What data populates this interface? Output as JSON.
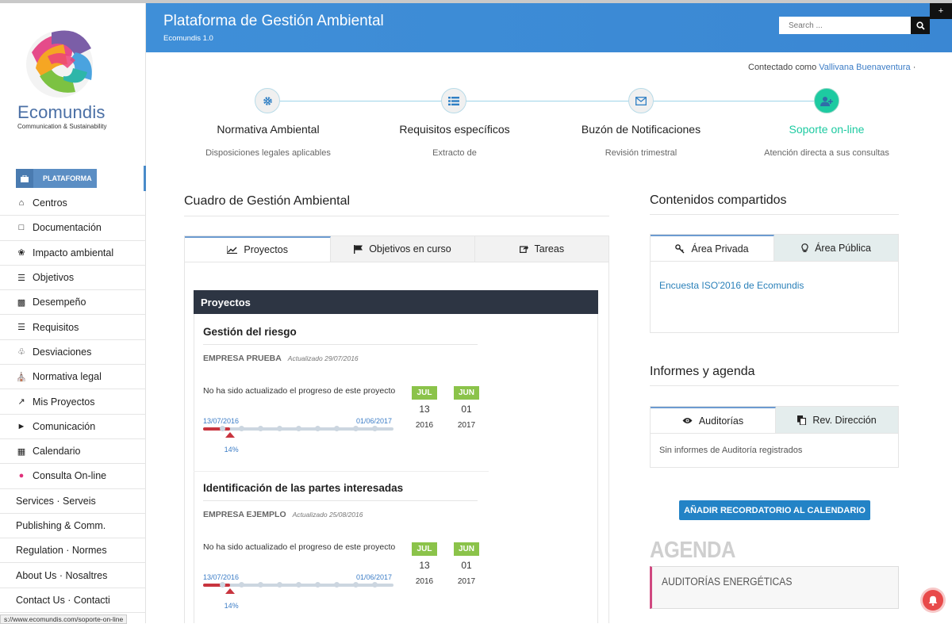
{
  "header": {
    "title": "Plataforma de Gestión Ambiental",
    "subtitle": "Ecomundis 1.0",
    "search_placeholder": "Search ..."
  },
  "brand": {
    "name": "Ecomundis",
    "tagline": "Communication & Sustainability"
  },
  "sidebar": {
    "platform_label": "PLATAFORMA",
    "items": [
      {
        "label": "Centros",
        "icon": "home-icon"
      },
      {
        "label": "Documentación",
        "icon": "document-icon"
      },
      {
        "label": "Impacto ambiental",
        "icon": "leaf-icon"
      },
      {
        "label": "Objetivos",
        "icon": "list-icon"
      },
      {
        "label": "Desempeño",
        "icon": "bar-chart-icon"
      },
      {
        "label": "Requisitos",
        "icon": "list-lines-icon"
      },
      {
        "label": "Desviaciones",
        "icon": "bell-icon"
      },
      {
        "label": "Normativa legal",
        "icon": "institution-icon"
      },
      {
        "label": "Mis Proyectos",
        "icon": "line-chart-icon"
      },
      {
        "label": "Comunicación",
        "icon": "megaphone-icon"
      },
      {
        "label": "Calendario",
        "icon": "calendar-icon"
      },
      {
        "label": "Consulta On-line",
        "icon": "chat-icon"
      },
      {
        "label": "Services · Serveis",
        "icon": ""
      },
      {
        "label": "Publishing & Comm.",
        "icon": ""
      },
      {
        "label": "Regulation · Normes",
        "icon": ""
      },
      {
        "label": "About Us · Nosaltres",
        "icon": ""
      },
      {
        "label": "Contact Us · Contacti",
        "icon": ""
      }
    ]
  },
  "status_url": "s://www.ecomundis.com/soporte-on-line",
  "connected": {
    "prefix": "Contectado como",
    "user": "Vallivana Buenaventura",
    "suffix": "·"
  },
  "steps": [
    {
      "title": "Normativa Ambiental",
      "desc": "Disposiciones legales aplicables",
      "icon": "gear-icon"
    },
    {
      "title": "Requisitos específicos",
      "desc": "Extracto de",
      "icon": "list-icon"
    },
    {
      "title": "Buzón de Notificaciones",
      "desc": "Revisión trimestral",
      "icon": "envelope-icon"
    },
    {
      "title": "Soporte on-line",
      "desc": "Atención directa a sus consultas",
      "icon": "user-plus-icon"
    }
  ],
  "main": {
    "title": "Cuadro de Gestión Ambiental",
    "tabs": [
      {
        "label": "Proyectos",
        "icon": "line-chart-icon"
      },
      {
        "label": "Objetivos en curso",
        "icon": "flag-icon"
      },
      {
        "label": "Tareas",
        "icon": "share-icon"
      }
    ],
    "projects_header": "Proyectos",
    "projects": [
      {
        "name": "Gestión del riesgo",
        "company": "EMPRESA PRUEBA",
        "updated": "Actualizado 29/07/2016",
        "message": "No ha sido actualizado el progreso de este proyecto",
        "start": "13/07/2016",
        "end": "01/06/2017",
        "progress_pct": 14,
        "progress_label": "14%",
        "start_cal": {
          "month": "JUL",
          "day": "13",
          "year": "2016"
        },
        "end_cal": {
          "month": "JUN",
          "day": "01",
          "year": "2017"
        }
      },
      {
        "name": "Identificación de las partes interesadas",
        "company": "EMPRESA EJEMPLO",
        "updated": "Actualizado 25/08/2016",
        "message": "No ha sido actualizado el progreso de este proyecto",
        "start": "13/07/2016",
        "end": "01/06/2017",
        "progress_pct": 14,
        "progress_label": "14%",
        "start_cal": {
          "month": "JUL",
          "day": "13",
          "year": "2016"
        },
        "end_cal": {
          "month": "JUN",
          "day": "01",
          "year": "2017"
        }
      }
    ]
  },
  "shared": {
    "title": "Contenidos compartidos",
    "tabs": [
      {
        "label": "Área Privada",
        "icon": "key-icon"
      },
      {
        "label": "Área Pública",
        "icon": "lightbulb-icon"
      }
    ],
    "link": "Encuesta ISO'2016 de Ecomundis"
  },
  "reports": {
    "title": "Informes y agenda",
    "tabs": [
      {
        "label": "Auditorías",
        "icon": "eye-icon"
      },
      {
        "label": "Rev. Dirección",
        "icon": "copy-icon"
      }
    ],
    "empty": "Sin informes de Auditoría registrados",
    "button": "AÑADIR RECORDATORIO AL CALENDARIO"
  },
  "agenda": {
    "title": "AGENDA",
    "item": "AUDITORÍAS ENERGÉTICAS"
  },
  "colors": {
    "header_blue": "#3f8fd8",
    "accent_teal": "#1dcaa1",
    "progress_red": "#c8343e",
    "calendar_green": "#8bc34a",
    "dark_panel": "#2d3543"
  }
}
